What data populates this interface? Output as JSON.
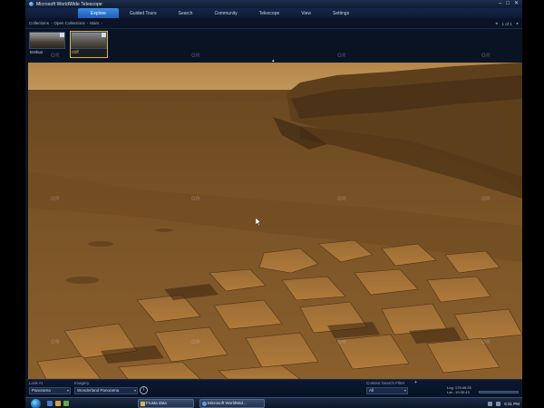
{
  "window": {
    "title": "Microsoft WorldWide Telescope",
    "controls": [
      "–",
      "□",
      "✕"
    ]
  },
  "ribbon": {
    "tabs": [
      {
        "label": "Explore",
        "active": true
      },
      {
        "label": "Guided Tours",
        "active": false
      },
      {
        "label": "Search",
        "active": false
      },
      {
        "label": "Community",
        "active": false
      },
      {
        "label": "Telescope",
        "active": false
      },
      {
        "label": "View",
        "active": false
      },
      {
        "label": "Settings",
        "active": false
      }
    ]
  },
  "breadcrumb": {
    "items": [
      "Collections",
      "Open Collections",
      "Mars"
    ],
    "separator": "›"
  },
  "pager": {
    "prev": "◂",
    "text": "1 of 1",
    "next": "▸"
  },
  "thumbnails": [
    {
      "label": "Erebus",
      "selected": false
    },
    {
      "label": "Cliff",
      "selected": true
    }
  ],
  "watermark_text": "OR",
  "collapse_glyph": "▴",
  "bottom_panel": {
    "look_at_label": "Look At",
    "look_at_value": "Panorama",
    "imagery_label": "Imagery",
    "imagery_value": "Wonderland Panorama",
    "info_glyph": "i",
    "filter_label": "Context Search Filter",
    "filter_value": "All",
    "plus_glyph": "+",
    "lng": "Lng: 179:45:25",
    "lat": "Lat: -19:30:43"
  },
  "taskbar": {
    "buttons": [
      {
        "label": "Frusta data"
      },
      {
        "label": "Microsoft WorldWid..."
      }
    ],
    "clock": "6:31 PM"
  },
  "colors": {
    "ribbon_active": "#2f78d0",
    "selected_thumb": "#d7b23a",
    "mars_sky": "#b88a4f",
    "mars_ground": "#7a5426"
  },
  "icons": {
    "app": "globe-icon",
    "start": "windows-start-icon",
    "info": "info-icon"
  }
}
